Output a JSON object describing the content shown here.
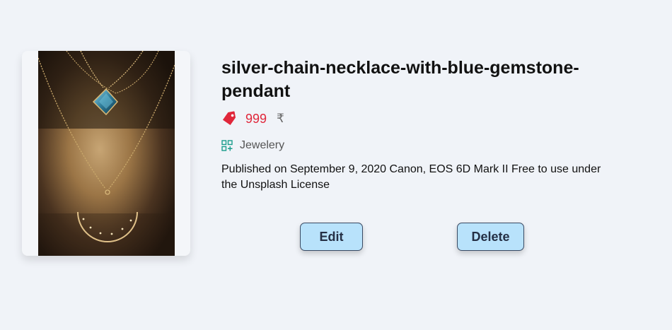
{
  "product": {
    "title": "silver-chain-necklace-with-blue-gemstone-pendant",
    "price": "999",
    "currency": "₹",
    "category": "Jewelery",
    "description": "Published on September 9, 2020 Canon, EOS 6D Mark II Free to use under the Unsplash License",
    "image_icon": "necklace-photo"
  },
  "actions": {
    "edit_label": "Edit",
    "delete_label": "Delete"
  },
  "icons": {
    "price": "tag-icon",
    "category": "category-grid-icon"
  },
  "colors": {
    "background": "#f0f3f8",
    "price": "#e0263a",
    "category_icon": "#1a9c8c",
    "button_bg": "#b8e2fb",
    "button_border": "#3a4a63"
  }
}
